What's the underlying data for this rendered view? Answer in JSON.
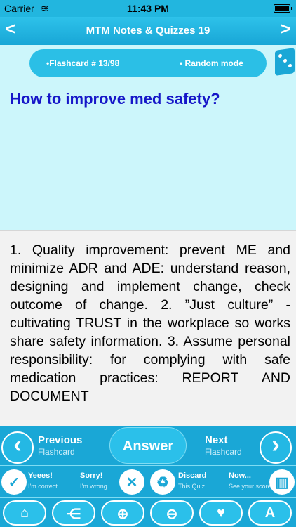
{
  "status": {
    "carrier": "Carrier",
    "time": "11:43 PM"
  },
  "nav": {
    "title": "MTM Notes & Quizzes 19",
    "back_glyph": "<",
    "forward_glyph": ">"
  },
  "info": {
    "counter": "•Flashcard # 13/98",
    "mode": "• Random mode"
  },
  "question": "How to improve med safety?",
  "answer": "1. Quality improvement: prevent ME and minimize ADR and ADE: understand reason, designing and implement change, check outcome of change.   2. ”Just culture” - cultivating TRUST in the workplace so works share safety information.      3. Assume personal responsibility: for complying with safe medication practices: REPORT AND DOCUMENT",
  "controls": {
    "previous_main": "Previous",
    "previous_sub": "Flashcard",
    "answer_label": "Answer",
    "next_main": "Next",
    "next_sub": "Flashcard",
    "yes_main": "Yeees!",
    "yes_sub": "I'm correct",
    "sorry_main": "Sorry!",
    "sorry_sub": "I'm wrong",
    "discard_main": "Discard",
    "discard_sub": "This Quiz",
    "now_main": "Now...",
    "now_sub": "See your score"
  },
  "icons": {
    "back": "chevron-left-icon",
    "forward": "chevron-right-icon",
    "dice": "dice-icon",
    "home": "home-icon",
    "share": "share-icon",
    "zoom_in": "zoom-in-icon",
    "zoom_out": "zoom-out-icon",
    "bookmark": "heart-icon",
    "font": "font-icon"
  },
  "colors": {
    "accent": "#1aa7d6",
    "question_bg": "#ccf6fb",
    "question_text": "#1616c8"
  }
}
